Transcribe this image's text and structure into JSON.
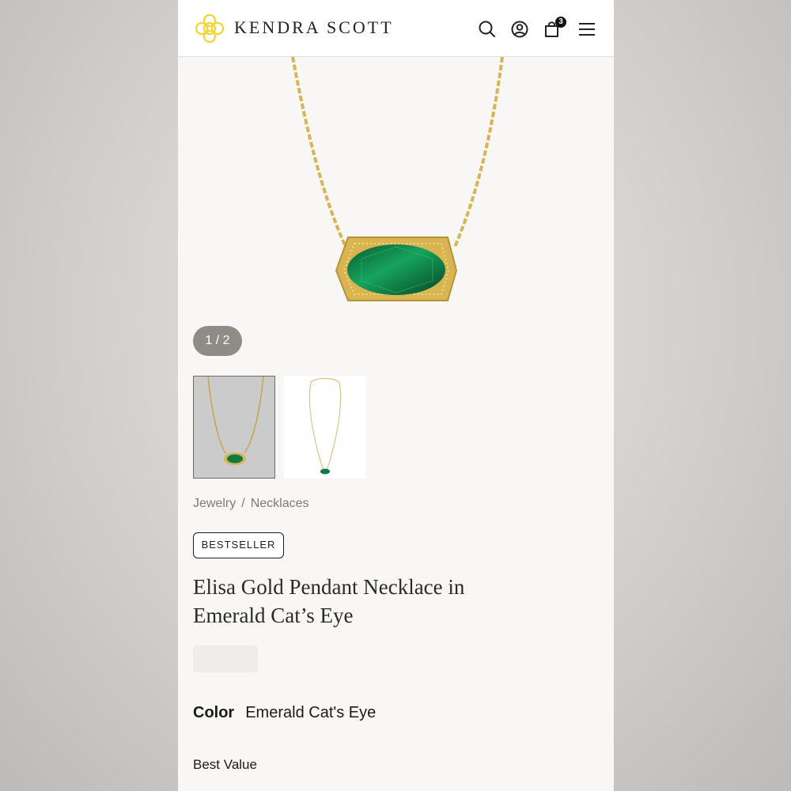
{
  "header": {
    "brand": "KENDRA SCOTT",
    "cart_count": "3",
    "icons": [
      "search-icon",
      "account-icon",
      "cart-icon",
      "menu-icon"
    ]
  },
  "gallery": {
    "counter": "1 / 2",
    "thumbnails": [
      "necklace-on-gray",
      "necklace-on-white"
    ]
  },
  "breadcrumb": {
    "items": [
      "Jewelry",
      "Necklaces"
    ],
    "separator": "/"
  },
  "product": {
    "badge": "BESTSELLER",
    "title_line1": "Elisa Gold Pendant Necklace in",
    "title_line2": "Emerald Cat’s Eye",
    "color_label": "Color",
    "color_value": "Emerald Cat's Eye",
    "best_value": "Best Value"
  },
  "colors": {
    "gold": "#d9b552",
    "emerald": "#0f7a44",
    "logo_yellow": "#f3d532"
  }
}
